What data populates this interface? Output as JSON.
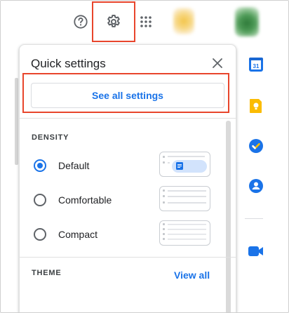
{
  "header": {
    "help_icon": "help-circle-icon",
    "settings_icon": "gear-icon",
    "apps_icon": "apps-grid-icon",
    "highlight_color": "#e8452c"
  },
  "quick_settings": {
    "title": "Quick settings",
    "close_icon": "close-icon",
    "see_all_label": "See all settings",
    "density": {
      "label": "DENSITY",
      "options": [
        {
          "label": "Default",
          "selected": true
        },
        {
          "label": "Comfortable",
          "selected": false
        },
        {
          "label": "Compact",
          "selected": false
        }
      ]
    },
    "theme": {
      "label": "THEME",
      "view_all_label": "View all"
    }
  },
  "side_panel": {
    "apps": [
      {
        "name": "Calendar",
        "icon": "calendar-icon",
        "date": "31",
        "color": "#1a73e8"
      },
      {
        "name": "Keep",
        "icon": "keep-icon",
        "color": "#fbbc04"
      },
      {
        "name": "Tasks",
        "icon": "tasks-icon",
        "color": "#1a73e8"
      },
      {
        "name": "Contacts",
        "icon": "contacts-icon",
        "color": "#1a73e8"
      },
      {
        "name": "Meet",
        "icon": "meet-icon",
        "color": "#1a73e8"
      }
    ]
  },
  "colors": {
    "accent": "#1a73e8",
    "text": "#202124",
    "highlight": "#e8452c"
  }
}
